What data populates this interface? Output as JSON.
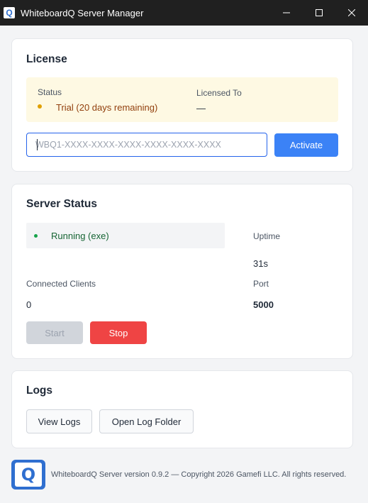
{
  "window": {
    "title": "WhiteboardQ Server Manager",
    "icon_glyph": "Q",
    "controls": [
      "minimize-icon",
      "maximize-icon",
      "close-icon"
    ]
  },
  "license": {
    "title": "License",
    "status_label": "Status",
    "status_value": "Trial (20 days remaining)",
    "licensed_to_label": "Licensed To",
    "licensed_to_value": "—",
    "key_placeholder": "WBQ1-XXXX-XXXX-XXXX-XXXX-XXXX-XXXX",
    "key_value": "",
    "activate_label": "Activate",
    "status_color": "#e0a000"
  },
  "server": {
    "title": "Server Status",
    "state_text": "Running (exe)",
    "state_color": "#16a34a",
    "uptime_label": "Uptime",
    "uptime_value": "31s",
    "clients_label": "Connected Clients",
    "clients_value": "0",
    "port_label": "Port",
    "port_value": "5000",
    "start_label": "Start",
    "start_enabled": false,
    "stop_label": "Stop"
  },
  "logs": {
    "title": "Logs",
    "view_label": "View Logs",
    "open_folder_label": "Open Log Folder"
  },
  "footer": {
    "logo_glyph": "Q",
    "text": "WhiteboardQ Server version 0.9.2 — Copyright 2026 Gamefi LLC. All rights reserved."
  },
  "colors": {
    "accent": "#3b82f6",
    "danger": "#ef4444",
    "titlebar": "#202020"
  }
}
